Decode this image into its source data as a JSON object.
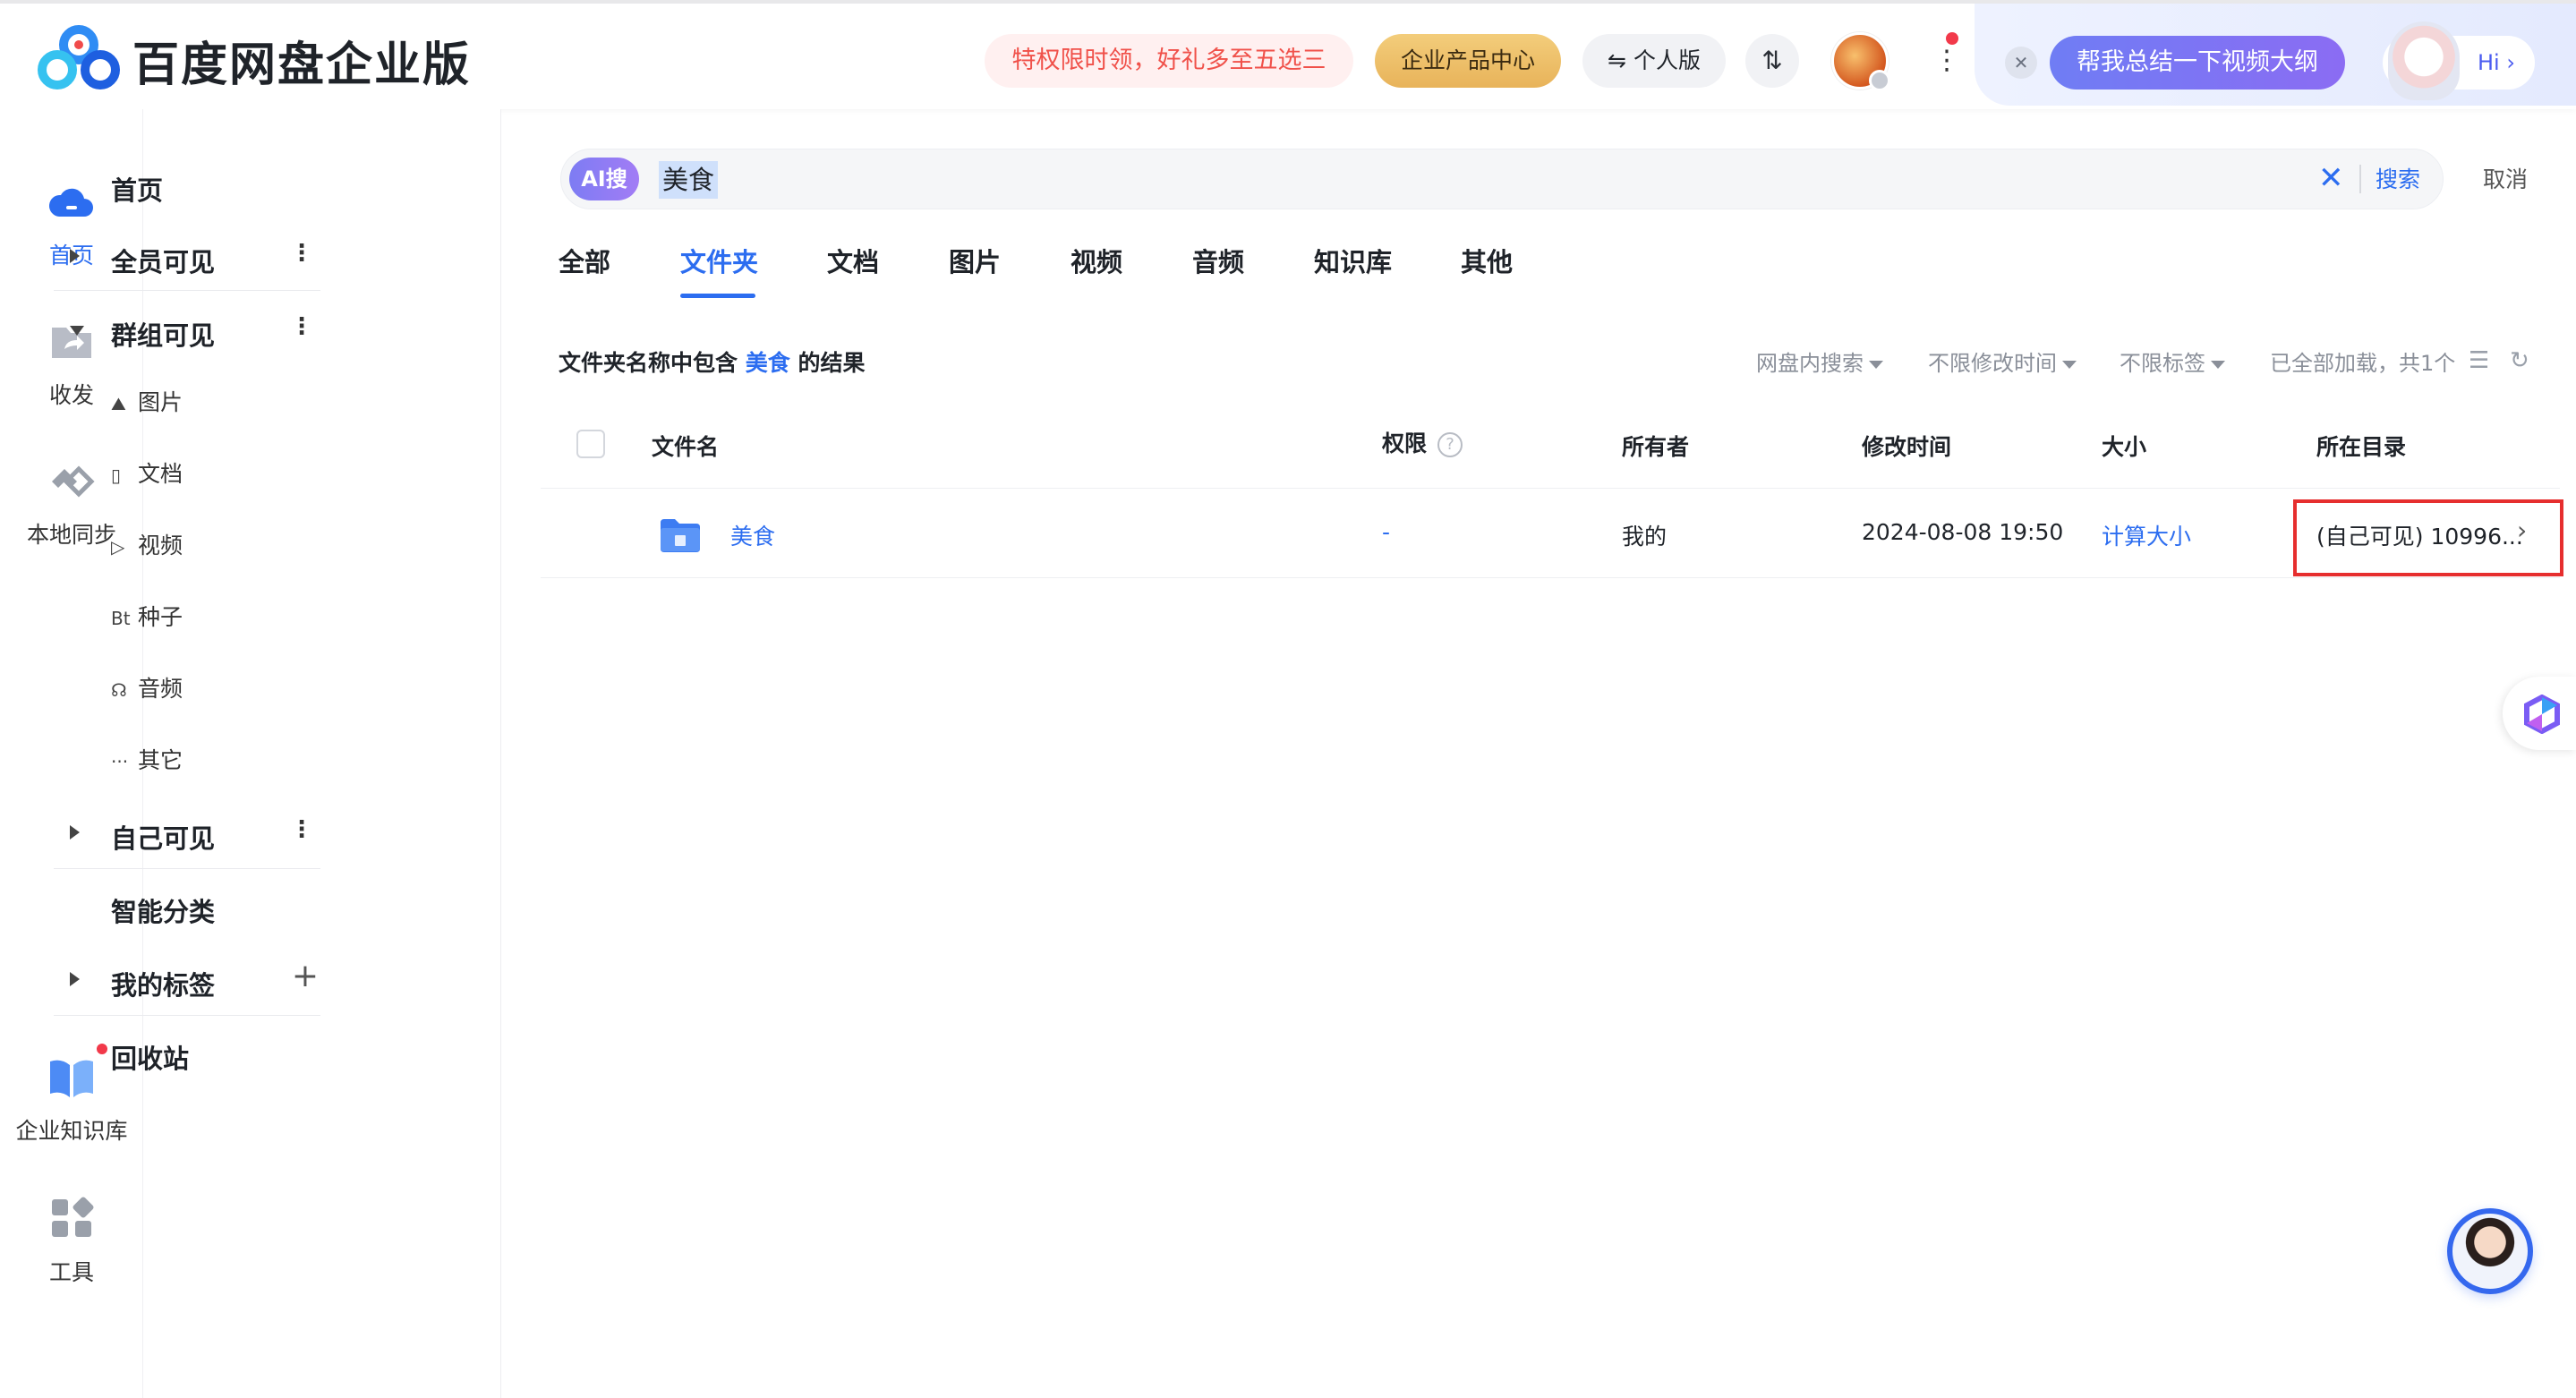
{
  "header": {
    "brand": "百度网盘企业版",
    "promo": "特权限时领，好礼多至五选三",
    "product_center": "企业产品中心",
    "personal": "个人版",
    "transfer_icon": "transfer-icon",
    "ai_prompt": "帮我总结一下视频大纲",
    "ai_hi": "Hi"
  },
  "rail": {
    "home": "首页",
    "share": "收发",
    "sync": "本地同步",
    "knowledge": "企业知识库",
    "tools": "工具"
  },
  "tree": {
    "home": "首页",
    "all_visible": "全员可见",
    "group_visible": "群组可见",
    "subs": [
      {
        "icon": "image-icon",
        "label": "图片"
      },
      {
        "icon": "doc-icon",
        "label": "文档"
      },
      {
        "icon": "video-icon",
        "label": "视频"
      },
      {
        "icon": "torrent-icon",
        "glyph": "Bt",
        "label": "种子"
      },
      {
        "icon": "audio-icon",
        "label": "音频"
      },
      {
        "icon": "more-icon",
        "label": "其它"
      }
    ],
    "self_visible": "自己可见",
    "smart_category": "智能分类",
    "my_tags": "我的标签",
    "recycle": "回收站"
  },
  "search": {
    "ai_badge": "AI搜",
    "query": "美食",
    "search_btn": "搜索",
    "cancel": "取消"
  },
  "tabs": [
    "全部",
    "文件夹",
    "文档",
    "图片",
    "视频",
    "音频",
    "知识库",
    "其他"
  ],
  "active_tab": "文件夹",
  "results": {
    "prefix": "文件夹名称中包含",
    "keyword": "美食",
    "suffix": "的结果",
    "filter_scope": "网盘内搜索",
    "filter_time": "不限修改时间",
    "filter_tags": "不限标签",
    "loaded": "已全部加载，共1个"
  },
  "table": {
    "columns": {
      "name": "文件名",
      "permission": "权限",
      "owner": "所有者",
      "modified": "修改时间",
      "size": "大小",
      "path": "所在目录"
    },
    "rows": [
      {
        "name": "美食",
        "permission": "-",
        "owner": "我的",
        "modified": "2024-08-08 19:50",
        "size": "计算大小",
        "path": "(自己可见) 10996..."
      }
    ]
  },
  "colors": {
    "accent": "#2c6df0",
    "highlight_box": "#e62e2e",
    "promo": "#f0514a"
  }
}
